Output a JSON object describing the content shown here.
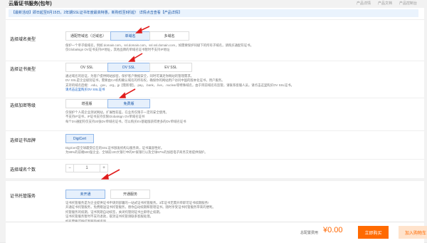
{
  "header": {
    "title": "云盾证书服务(包年)",
    "links": [
      "产品详情",
      "产品文档",
      "产品控制台"
    ]
  },
  "notice": "【最新活动】即日起至8月15日，2年期SSL证书年度最高特惠，新购低至8折起！ 详情点击查看【产品详情】",
  "domain_type": {
    "label": "选择域名类型",
    "options": [
      "通配符域名（泛域名）",
      "单域名",
      "多域名"
    ],
    "selected": 1,
    "desc": [
      "保护一个单子级域名，例如 domain.com，ssl.domain.com，ssl.ssl.domain.com，如需要保护同级下的所有子域名，请购买通配符证书。",
      "仅Globalsign OV证书支持IP地址，其他品牌的单域名证书暂时不支持IP地址"
    ]
  },
  "cert_type": {
    "label": "选择证书类型",
    "options": [
      "OV SSL",
      "DV SSL",
      "EV SSL"
    ],
    "selected": 1,
    "desc": [
      "通过域名的验证，为客户提供网站加密，保护客户数据安全，同时可满足你网站的管理需求。",
      "DV SSL是企业级别证书，需要由CA机构确认域名的所有权，确保你的网站用户访问中国的版本化证书，用户服务。",
      "支持的域名后缀：.edu，.gov，.org，jp【需新增】，.pay，.bank，.live，.nuclear等特殊域名，由于目前域名有监管，请联系客服人员，请点击这里购买OV SSL证书。",
      "请点击这里购买OV SSL证书"
    ]
  },
  "protection_level": {
    "label": "选择加密等级",
    "options": [
      "增强版",
      "免费版"
    ],
    "selected": 1,
    "desc": [
      "仅保护个人或企业测试网站，扩展性较差，在业务仅限于一定的安全使用。",
      "不支持IP证书，IP证书支持仅限Globalsign OV单域名证书",
      "每个DV通配符仅支持20张DV单域名证书，可以购买EV基础版获得更多的DV单域名证书"
    ]
  },
  "brand": {
    "label": "选择证书品牌",
    "options": [
      "DigiCert"
    ],
    "selected": 0,
    "desc": [
      "DigiCert是全球最受信任的SSL证书颁发机构与服务商，证书兼容性好。",
      "为99%的前端500强企业、全球前100大银行中的97家银行以及全球97%的加密电子商务交易提供保护。"
    ]
  },
  "domain_count": {
    "label": "选择域名个数",
    "value": "1",
    "minus": "−",
    "plus": "+"
  },
  "hosting": {
    "label": "证书托管服务",
    "options": [
      "未开通",
      "开通服务"
    ],
    "selected": 0,
    "desc": [
      "证书托管服务是为企业提供证书申请到部署的一站式证书托管服务。3年证书无需开单即可证书续期服务!",
      "开通证书托管服务，免费赠送证书托管服务，替你自动续期和管理证书。随时享受证书托管服务带来的便利。",
      "托管服务的续期，证书到期自动续签，关闭托管则证书立即停止续期。",
      "证书托管服务暂时不支持退款，取消证书托管请联系客服处理。",
      "如有需要可拨打客服热线咨询。"
    ]
  },
  "footer": {
    "cost_label": "总配置费用",
    "price": "¥0.00",
    "buy": "立即购买",
    "cart": "加入购物车"
  },
  "colors": {
    "accent": "#1a57a8",
    "orange": "#ff6a00",
    "arrow": "#e01d1d"
  }
}
